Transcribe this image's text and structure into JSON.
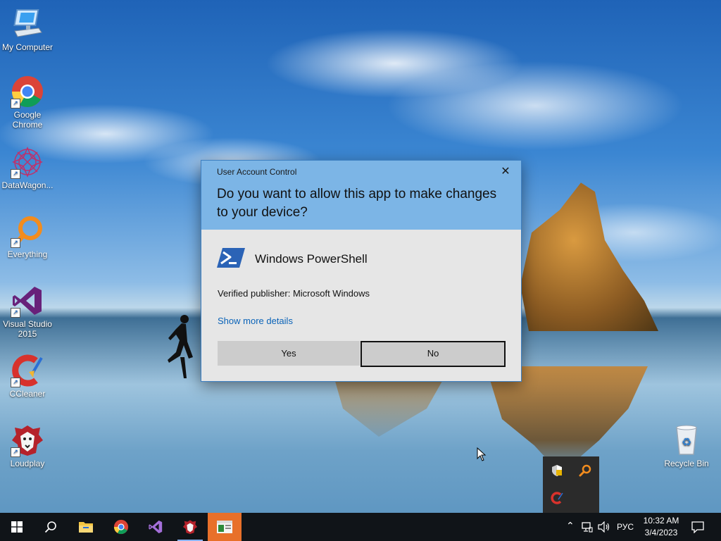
{
  "desktop": {
    "icons": [
      {
        "label": "My Computer"
      },
      {
        "label": "Google Chrome"
      },
      {
        "label": "DataWagon..."
      },
      {
        "label": "Everything"
      },
      {
        "label": "Visual Studio 2015"
      },
      {
        "label": "CCleaner"
      },
      {
        "label": "Loudplay"
      },
      {
        "label": "Recycle Bin"
      }
    ]
  },
  "uac": {
    "title": "User Account Control",
    "question": "Do you want to allow this app to make changes to your device?",
    "app_name": "Windows PowerShell",
    "publisher": "Verified publisher: Microsoft Windows",
    "details_link": "Show more details",
    "yes_label": "Yes",
    "no_label": "No",
    "colors": {
      "header": "#7cb5e6",
      "body": "#e6e6e6",
      "link": "#0a63b8"
    }
  },
  "taskbar": {
    "language": "РУС",
    "time": "10:32 AM",
    "date": "3/4/2023",
    "pinned": [
      "windows-start-icon",
      "search-icon",
      "file-explorer-icon",
      "chrome-icon",
      "visual-studio-icon",
      "loudplay-icon",
      "uac-window-icon"
    ]
  }
}
